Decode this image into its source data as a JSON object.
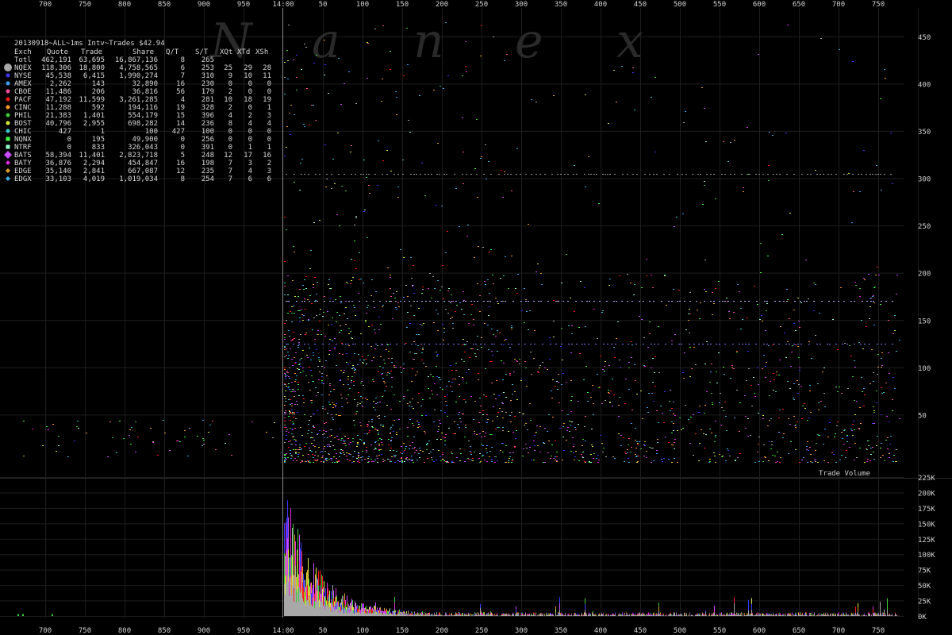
{
  "watermark": [
    "N",
    "a",
    "n",
    "e",
    "x"
  ],
  "chart_data": [
    {
      "type": "scatter",
      "title": "20130918~ALL~1ms Intv~Trades $42.94",
      "x_ticks_left": [
        "700",
        "750",
        "800",
        "850",
        "900",
        "950"
      ],
      "x_ticks_right": [
        "14:00",
        "50",
        "100",
        "150",
        "200",
        "250",
        "300",
        "350",
        "400",
        "450",
        "500",
        "550",
        "600",
        "650",
        "700",
        "750"
      ],
      "y_ticks": [
        "50",
        "100",
        "150",
        "200",
        "250",
        "300",
        "350",
        "400",
        "450"
      ],
      "ylim": [
        0,
        480
      ],
      "grid": true,
      "legend": {
        "columns": [
          "Exch",
          "Quote",
          "Trade",
          "Share",
          "Q/T",
          "S/T",
          "XQt",
          "XTd",
          "XSh"
        ],
        "rows": [
          {
            "exch": "Totl",
            "quote": "462,191",
            "trade": "63,695",
            "share": "16,867,136",
            "qt": "8",
            "st": "265",
            "xqt": "",
            "xtd": "",
            "xsh": "",
            "color": "",
            "marker": "none"
          },
          {
            "exch": "NQEX",
            "quote": "118,306",
            "trade": "18,800",
            "share": "4,758,565",
            "qt": "6",
            "st": "253",
            "xqt": "25",
            "xtd": "29",
            "xsh": "28",
            "color": "#a8a8a8",
            "marker": "bigcircle"
          },
          {
            "exch": "NYSE",
            "quote": "45,538",
            "trade": "6,415",
            "share": "1,990,274",
            "qt": "7",
            "st": "310",
            "xqt": "9",
            "xtd": "10",
            "xsh": "11",
            "color": "#3a3aff",
            "marker": "circle"
          },
          {
            "exch": "AMEX",
            "quote": "2,262",
            "trade": "143",
            "share": "32,890",
            "qt": "16",
            "st": "230",
            "xqt": "0",
            "xtd": "0",
            "xsh": "0",
            "color": "#3aa0ff",
            "marker": "circle"
          },
          {
            "exch": "CBOE",
            "quote": "11,486",
            "trade": "206",
            "share": "36,816",
            "qt": "56",
            "st": "179",
            "xqt": "2",
            "xtd": "0",
            "xsh": "0",
            "color": "#ff4aa0",
            "marker": "circle"
          },
          {
            "exch": "PACF",
            "quote": "47,192",
            "trade": "11,599",
            "share": "3,261,285",
            "qt": "4",
            "st": "281",
            "xqt": "10",
            "xtd": "18",
            "xsh": "19",
            "color": "#ff1a1a",
            "marker": "circle"
          },
          {
            "exch": "CINC",
            "quote": "11,288",
            "trade": "592",
            "share": "194,116",
            "qt": "19",
            "st": "328",
            "xqt": "2",
            "xtd": "0",
            "xsh": "1",
            "color": "#ff9a2a",
            "marker": "circle"
          },
          {
            "exch": "PHIL",
            "quote": "21,383",
            "trade": "1,401",
            "share": "554,179",
            "qt": "15",
            "st": "396",
            "xqt": "4",
            "xtd": "2",
            "xsh": "3",
            "color": "#3acc3a",
            "marker": "circle"
          },
          {
            "exch": "BOST",
            "quote": "40,796",
            "trade": "2,955",
            "share": "698,282",
            "qt": "14",
            "st": "236",
            "xqt": "8",
            "xtd": "4",
            "xsh": "4",
            "color": "#d8e83a",
            "marker": "circle"
          },
          {
            "exch": "CHIC",
            "quote": "427",
            "trade": "1",
            "share": "100",
            "qt": "427",
            "st": "100",
            "xqt": "0",
            "xtd": "0",
            "xsh": "0",
            "color": "#3acccc",
            "marker": "circle"
          },
          {
            "exch": "NQNX",
            "quote": "0",
            "trade": "195",
            "share": "49,900",
            "qt": "0",
            "st": "256",
            "xqt": "0",
            "xtd": "0",
            "xsh": "0",
            "color": "#3aff3a",
            "marker": "square"
          },
          {
            "exch": "NTRF",
            "quote": "0",
            "trade": "833",
            "share": "326,043",
            "qt": "0",
            "st": "391",
            "xqt": "0",
            "xtd": "1",
            "xsh": "1",
            "color": "#9affd0",
            "marker": "square"
          },
          {
            "exch": "BATS",
            "quote": "58,394",
            "trade": "11,401",
            "share": "2,823,718",
            "qt": "5",
            "st": "248",
            "xqt": "12",
            "xtd": "17",
            "xsh": "16",
            "color": "#c84aff",
            "marker": "bigdiamond"
          },
          {
            "exch": "BATY",
            "quote": "36,876",
            "trade": "2,294",
            "share": "454,847",
            "qt": "16",
            "st": "198",
            "xqt": "7",
            "xtd": "3",
            "xsh": "2",
            "color": "#e02ae0",
            "marker": "diamond"
          },
          {
            "exch": "EDGE",
            "quote": "35,140",
            "trade": "2,841",
            "share": "667,087",
            "qt": "12",
            "st": "235",
            "xqt": "7",
            "xtd": "4",
            "xsh": "3",
            "color": "#e0a02a",
            "marker": "diamond"
          },
          {
            "exch": "EDGX",
            "quote": "33,103",
            "trade": "4,019",
            "share": "1,019,034",
            "qt": "8",
            "st": "254",
            "xqt": "7",
            "xtd": "6",
            "xsh": "6",
            "color": "#3ab0e0",
            "marker": "diamond"
          }
        ]
      }
    },
    {
      "type": "bar",
      "title": "Trade Volume",
      "y_ticks": [
        "0K",
        "25K",
        "50K",
        "75K",
        "100K",
        "125K",
        "150K",
        "175K",
        "200K",
        "225K"
      ],
      "ylim": [
        0,
        225000
      ],
      "x_ticks_left": [
        "700",
        "750",
        "800",
        "850",
        "900",
        "950"
      ],
      "x_ticks_right": [
        "14:00",
        "50",
        "100",
        "150",
        "200",
        "250",
        "300",
        "350",
        "400",
        "450",
        "500",
        "550",
        "600",
        "650",
        "700",
        "750"
      ],
      "series_colors": [
        "#a8a8a8",
        "#3a3aff",
        "#ff1a1a",
        "#3acc3a",
        "#c84aff",
        "#e02ae0",
        "#e0a02a",
        "#d8e83a"
      ],
      "peak": 215000
    }
  ]
}
